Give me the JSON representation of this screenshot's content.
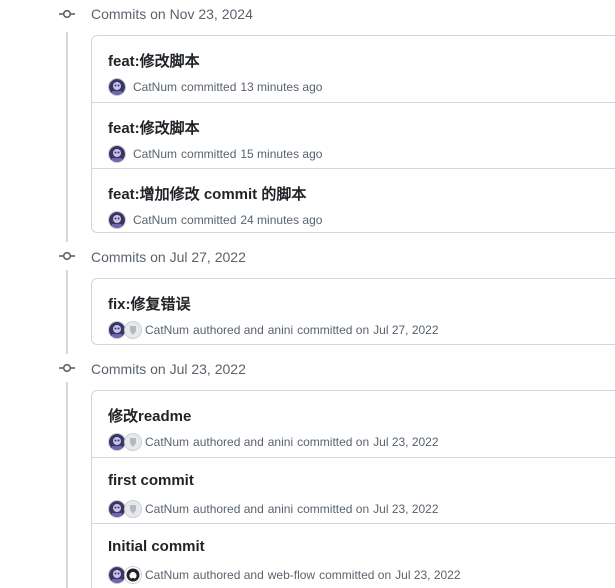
{
  "groups": [
    {
      "title": "Commits on Nov 23, 2024",
      "commits": [
        {
          "message": "feat:修改脚本",
          "author": "CatNum",
          "action": "committed",
          "time": "13 minutes ago"
        },
        {
          "message": "feat:修改脚本",
          "author": "CatNum",
          "action": "committed",
          "time": "15 minutes ago"
        },
        {
          "message": "feat:增加修改 commit 的脚本",
          "author": "CatNum",
          "action": "committed",
          "time": "24 minutes ago"
        }
      ]
    },
    {
      "title": "Commits on Jul 27, 2022",
      "commits": [
        {
          "message": "fix:修复错误",
          "author": "CatNum",
          "authored": "authored and",
          "committer": "anini",
          "action": "committed on",
          "time": "Jul 27, 2022"
        }
      ]
    },
    {
      "title": "Commits on Jul 23, 2022",
      "commits": [
        {
          "message": "修改readme",
          "author": "CatNum",
          "authored": "authored and",
          "committer": "anini",
          "action": "committed on",
          "time": "Jul 23, 2022"
        },
        {
          "message": "first commit",
          "author": "CatNum",
          "authored": "authored and",
          "committer": "anini",
          "action": "committed on",
          "time": "Jul 23, 2022"
        },
        {
          "message": "Initial commit",
          "author": "CatNum",
          "authored": "authored and",
          "committer": "web-flow",
          "action": "committed on",
          "time": "Jul 23, 2022"
        }
      ]
    }
  ],
  "icons": {
    "commit": "git-commit-icon",
    "author_avatar": "catnum-avatar",
    "committer_avatar": "anini-avatar",
    "webflow_avatar": "github-octocat-avatar"
  },
  "colors": {
    "border": "#d0d7de",
    "muted_text": "#59636e",
    "primary_text": "#1f2328"
  }
}
